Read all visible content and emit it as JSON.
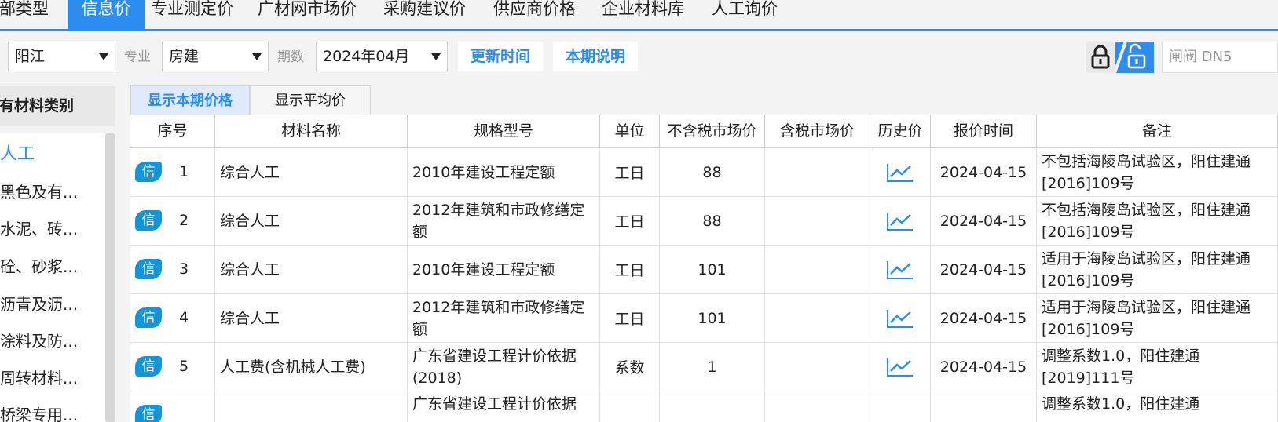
{
  "top_tabs": [
    "全部类型",
    "信息价",
    "专业测定价",
    "广材网市场价",
    "采购建议价",
    "供应商价格",
    "企业材料库",
    "人工询价"
  ],
  "active_top_tab": "信息价",
  "filters": {
    "region_value": "阳江",
    "major_label": "专业",
    "major_value": "房建",
    "period_label": "期数",
    "period_value": "2024年04月",
    "update_time_btn": "更新时间",
    "period_note_btn": "本期说明"
  },
  "right_input_placeholder": "闸阀 DN5",
  "left_panel": {
    "title": "所有材料类别",
    "items": [
      "人工",
      "黑色及有...",
      "水泥、砖...",
      "砼、砂浆...",
      "沥青及沥...",
      "涂料及防...",
      "周转材料...",
      "桥梁专用..."
    ],
    "active_index": 0
  },
  "price_tabs": [
    "显示本期价格",
    "显示平均价"
  ],
  "table": {
    "headers": [
      "序号",
      "材料名称",
      "规格型号",
      "单位",
      "不含税市场价",
      "含税市场价",
      "历史价",
      "报价时间",
      "备注"
    ],
    "badge_label": "信",
    "rows": [
      {
        "idx": "1",
        "name": "综合人工",
        "spec": "2010年建设工程定额",
        "unit": "工日",
        "price_ex_tax": "88",
        "price_inc_tax": "",
        "date": "2024-04-15",
        "note": "不包括海陵岛试验区，阳住建通[2016]109号"
      },
      {
        "idx": "2",
        "name": "综合人工",
        "spec": "2012年建筑和市政修缮定额",
        "unit": "工日",
        "price_ex_tax": "88",
        "price_inc_tax": "",
        "date": "2024-04-15",
        "note": "不包括海陵岛试验区，阳住建通[2016]109号"
      },
      {
        "idx": "3",
        "name": "综合人工",
        "spec": "2010年建设工程定额",
        "unit": "工日",
        "price_ex_tax": "101",
        "price_inc_tax": "",
        "date": "2024-04-15",
        "note": "适用于海陵岛试验区，阳住建通[2016]109号"
      },
      {
        "idx": "4",
        "name": "综合人工",
        "spec": "2012年建筑和市政修缮定额",
        "unit": "工日",
        "price_ex_tax": "101",
        "price_inc_tax": "",
        "date": "2024-04-15",
        "note": "适用于海陵岛试验区，阳住建通[2016]109号"
      },
      {
        "idx": "5",
        "name": "人工费(含机械人工费)",
        "spec": "广东省建设工程计价依据(2018)",
        "unit": "系数",
        "price_ex_tax": "1",
        "price_inc_tax": "",
        "date": "2024-04-15",
        "note": "调整系数1.0，阳住建通[2019]111号"
      },
      {
        "idx": "",
        "name": "",
        "spec": "广东省建设工程计价依据",
        "unit": "",
        "price_ex_tax": "",
        "price_inc_tax": "",
        "date": "",
        "note": "调整系数1.0，阳住建通"
      }
    ]
  },
  "colors": {
    "accent": "#2d8cf0",
    "badge": "#1296db"
  }
}
